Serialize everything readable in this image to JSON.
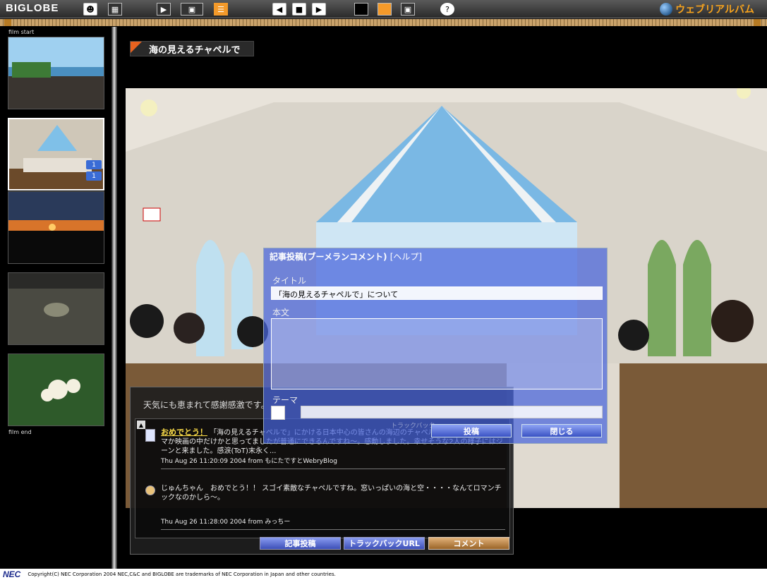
{
  "toolbar": {
    "logo": "BIGLOBE",
    "brand": "ウェブリアルバム",
    "help_glyph": "?"
  },
  "sidebar": {
    "film_start": "film start",
    "film_end": "film end",
    "selected_badges": [
      "1",
      "1"
    ]
  },
  "page": {
    "title": "海の見えるチャペルで",
    "caption": "天気にも恵まれて感謝感激です。"
  },
  "comments": {
    "entries": [
      {
        "heading": "おめでとう！",
        "text": "「海の見えるチャペルで」にかける日本中心の皆さんの海辺のチャペルでの挙式なんて、ドラマか映画の中だけかと思ってましたが普通にできるんですね〜。感動しました。幸せそうな2人の様子にはジーンと来ました。感涙(ToT)末永く...",
        "meta": "Thu Aug 26 11:20:09 2004 from もにたですとWebryBlog"
      },
      {
        "heading": "",
        "text": "じゅんちゃん　おめでとう！！ スゴイ素敵なチャペルですね。窓いっぱいの海と空・・・・なんてロマンチックなのかしら〜。",
        "meta": "Thu Aug 26 11:28:00 2004 from みっちー"
      }
    ],
    "buttons": {
      "post": "記事投稿",
      "trackback": "トラックバックURL",
      "comment": "コメント"
    }
  },
  "dialog": {
    "title": "記事投稿(ブーメランコメント)",
    "help": "[ヘルプ]",
    "title_label": "タイトル",
    "title_value": "「海の見えるチャペルで」について",
    "body_label": "本文",
    "theme_label": "テーマ",
    "ghost_text": "トラックバック",
    "post_button": "投稿",
    "close_button": "閉じる"
  },
  "footer": {
    "logo": "NEC",
    "copyright": "Copyright(C) NEC Corporation 2004 NEC,C&C and BIGLOBE are trademarks of NEC Corporation in Japan and other countries."
  }
}
